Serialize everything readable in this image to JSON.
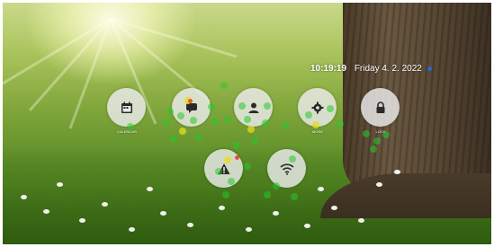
{
  "status": {
    "time": "10:19:19",
    "date": "Friday 4. 2. 2022"
  },
  "tiles": [
    {
      "icon": "calendar-icon",
      "label": "CALENDAR"
    },
    {
      "icon": "messages-icon",
      "label": ""
    },
    {
      "icon": "person-icon",
      "label": ""
    },
    {
      "icon": "gear-icon",
      "label": "MORE"
    },
    {
      "icon": "lock-icon",
      "label": "LOCK"
    },
    {
      "icon": "warning-icon",
      "label": ""
    },
    {
      "icon": "wifi-icon",
      "label": ""
    }
  ],
  "colors": {
    "tile": "#ebebeb",
    "icon": "#2a2a2a",
    "gaze_green": "#28c828",
    "gaze_yellow": "#e6dc1e",
    "gaze_red": "#e6281e",
    "status_dot": "#2b63d6"
  }
}
